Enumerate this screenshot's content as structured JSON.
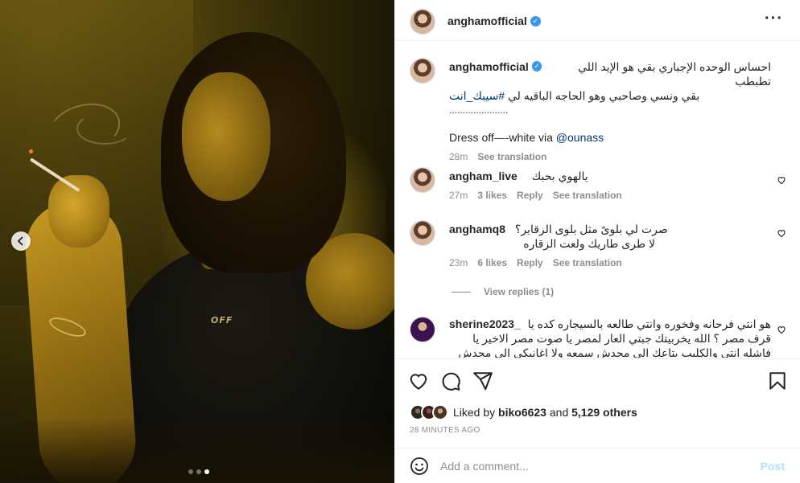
{
  "post": {
    "username": "anghamofficial",
    "verified": true,
    "more_icon": "more-horizontal-icon",
    "media": {
      "shirt_text": "OFF",
      "carousel_total": 3,
      "carousel_active": 3
    }
  },
  "caption": {
    "username": "anghamofficial",
    "line1": "احساس الوحده الإجباري بقي هو الإيد اللي تطبطب",
    "line2_prefix": "بقي ونسي وصاحبي وهو الحاجه الباقيه لي ",
    "hashtag": "#سيبك_انت",
    "dots": "......................",
    "credit_text": "Dress off—-white via ",
    "credit_mention": "@ounass",
    "time": "28m",
    "see_translation": "See translation"
  },
  "comments": [
    {
      "username": "angham_live",
      "text": "يالهوي بحبك",
      "time": "27m",
      "likes": "3 likes",
      "reply": "Reply",
      "see_translation": "See translation"
    },
    {
      "username": "anghamq8",
      "text_line1": "صرت لي بلوىً مثل بلوى الزقاير؟",
      "text_line2": "لا طرى طاريك ولعت الزقاره",
      "time": "23m",
      "likes": "6 likes",
      "reply": "Reply",
      "see_translation": "See translation",
      "view_replies": "View replies (1)"
    },
    {
      "username": "sherine2023_",
      "text_line1": "هو انتي فرحانه وفخوره وانتي طالعه بالسيجاره كده يا",
      "text_line2": "قرف مصر ؟ الله يخربيتك جبتي العار لمصر يا صوت مصر الاخير يا",
      "text_line3": "فاشله انتي والكليب بتاعك الي محدش سمعه ولا اغانيكي الي محدش"
    }
  ],
  "actions": {
    "like_icon": "heart-icon",
    "comment_icon": "comment-icon",
    "share_icon": "share-icon",
    "save_icon": "bookmark-icon"
  },
  "likes": {
    "prefix": "Liked by ",
    "user": "biko6623",
    "middle": " and ",
    "others": "5,129 others"
  },
  "posted_ago": "28 MINUTES AGO",
  "add_comment": {
    "placeholder": "Add a comment...",
    "post_label": "Post"
  }
}
